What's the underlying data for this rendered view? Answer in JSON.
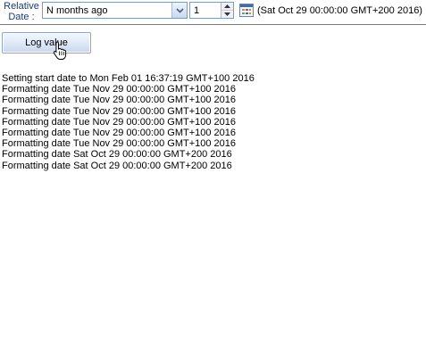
{
  "relative_date": {
    "label_line1": "Relative",
    "label_line2": "Date :",
    "mode_selected": "N months ago",
    "amount_value": "1",
    "resolved_date": "(Sat Oct 29 00:00:00 GMT+200 2016)"
  },
  "actions": {
    "log_button_label": "Log value"
  },
  "log": {
    "lines": [
      "Setting start date to Mon Feb 01 16:37:19 GMT+100 2016",
      "Formatting date Tue Nov 29 00:00:00 GMT+100 2016",
      "Formatting date Tue Nov 29 00:00:00 GMT+100 2016",
      "Formatting date Tue Nov 29 00:00:00 GMT+100 2016",
      "Formatting date Tue Nov 29 00:00:00 GMT+100 2016",
      "Formatting date Tue Nov 29 00:00:00 GMT+100 2016",
      "Formatting date Tue Nov 29 00:00:00 GMT+100 2016",
      "Formatting date Sat Oct 29 00:00:00 GMT+200 2016",
      "Formatting date Sat Oct 29 00:00:00 GMT+200 2016"
    ]
  },
  "icons": {
    "dropdown": "chevron-down-icon",
    "spin_up": "caret-up-icon",
    "spin_down": "caret-down-icon",
    "calendar": "calendar-icon",
    "cursor": "hand-pointer-icon"
  },
  "colors": {
    "label_text": "#1c3b78",
    "panel_border": "#5b7fb0",
    "button_border": "#8ea6c7"
  }
}
